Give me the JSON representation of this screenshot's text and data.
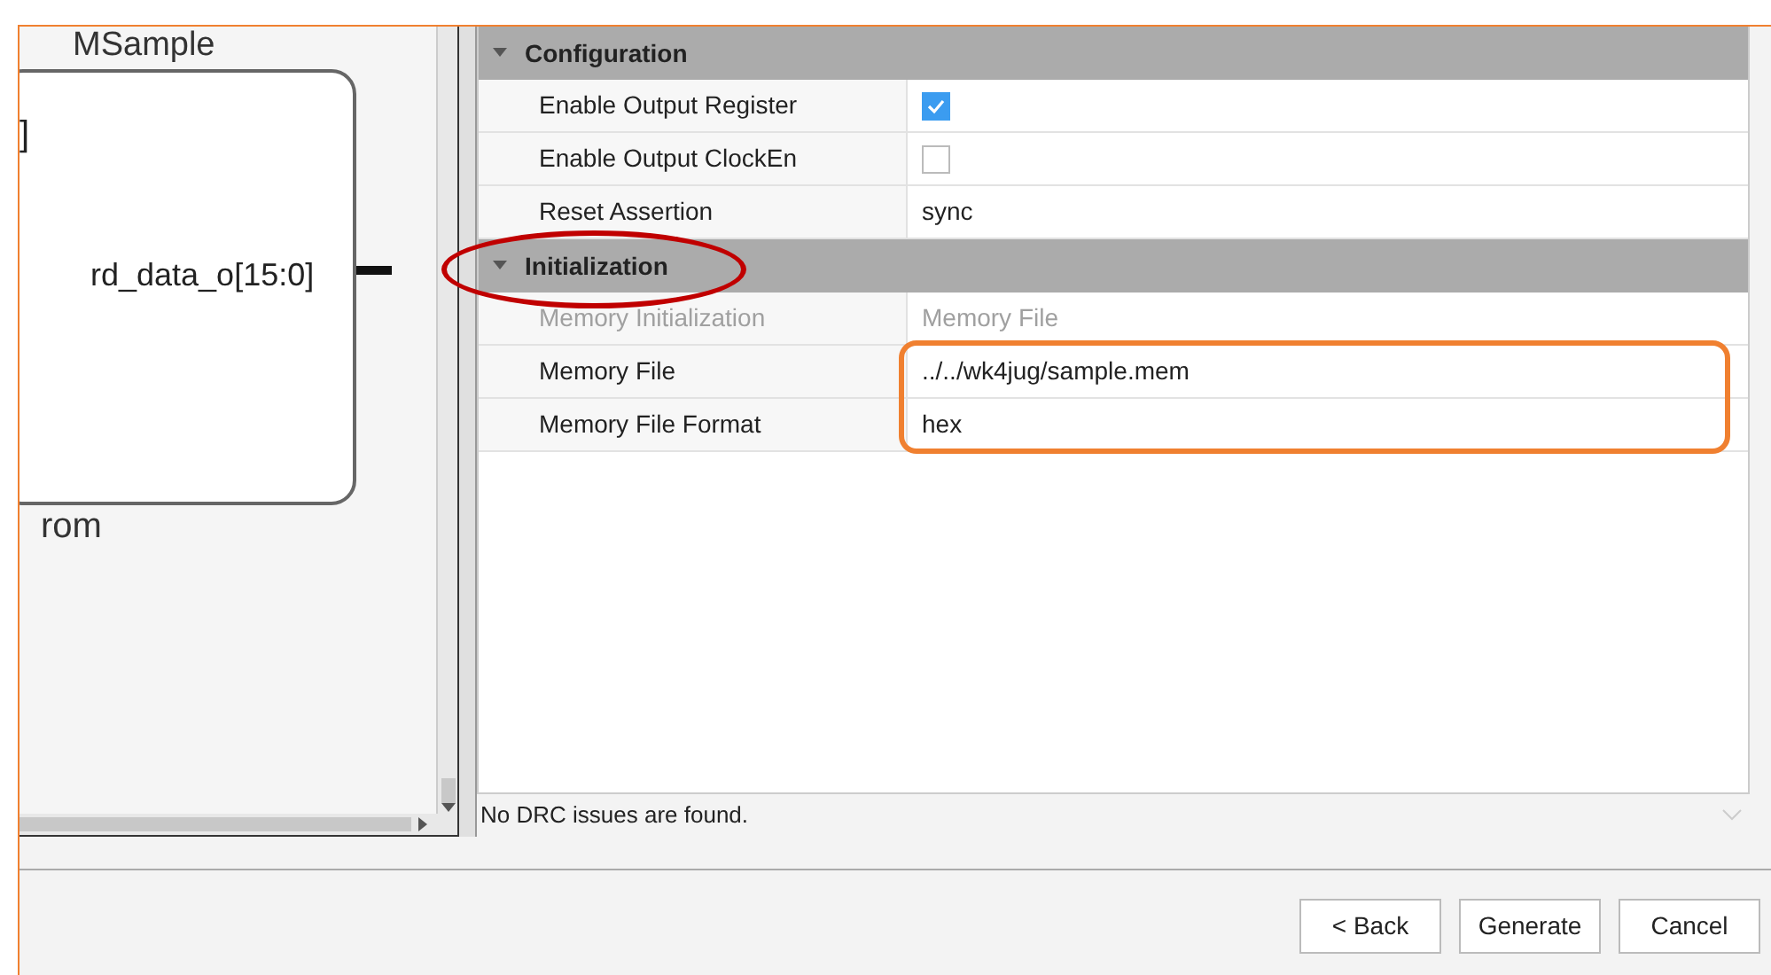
{
  "schematic": {
    "title": "MSample",
    "port_left": "]",
    "port_right": "rd_data_o[15:0]",
    "instance": "rom"
  },
  "properties": {
    "groups": [
      {
        "title": "Configuration",
        "expanded": true,
        "rows": [
          {
            "name": "Enable Output Register",
            "kind": "checkbox",
            "checked": true,
            "disabled": false
          },
          {
            "name": "Enable Output ClockEn",
            "kind": "checkbox",
            "checked": false,
            "disabled": false
          },
          {
            "name": "Reset Assertion",
            "kind": "text",
            "value": "sync",
            "disabled": false
          }
        ]
      },
      {
        "title": "Initialization",
        "expanded": true,
        "rows": [
          {
            "name": "Memory Initialization",
            "kind": "text",
            "value": "Memory File",
            "disabled": true
          },
          {
            "name": "Memory File",
            "kind": "text",
            "value": "../../wk4jug/sample.mem",
            "disabled": false
          },
          {
            "name": "Memory File Format",
            "kind": "text",
            "value": "hex",
            "disabled": false
          }
        ]
      }
    ]
  },
  "status": "No DRC issues are found.",
  "buttons": [
    "< Back",
    "Generate",
    "Cancel"
  ]
}
